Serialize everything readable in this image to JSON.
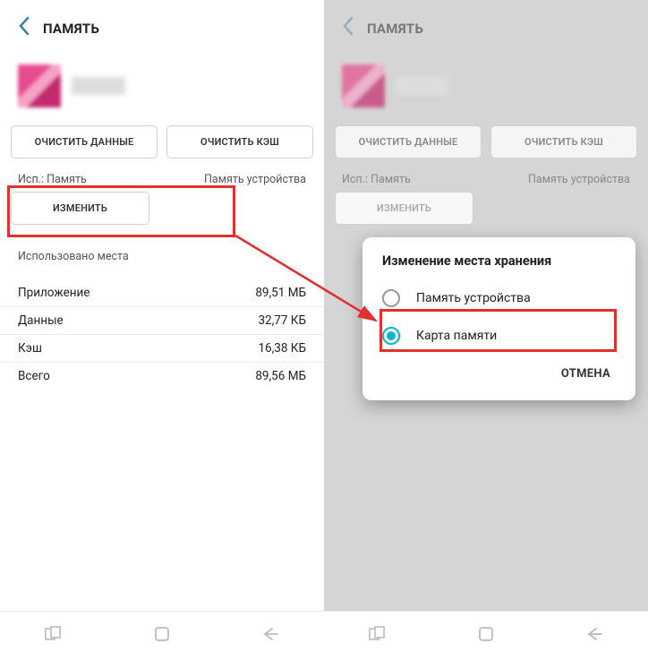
{
  "left": {
    "header_title": "ПАМЯТЬ",
    "clear_data_btn": "ОЧИСТИТЬ ДАННЫЕ",
    "clear_cache_btn": "ОЧИСТИТЬ КЭШ",
    "used_label": "Исп.: Память",
    "storage_label": "Память устройства",
    "change_btn": "ИЗМЕНИТЬ",
    "used_space_label": "Использовано места",
    "rows": [
      {
        "label": "Приложение",
        "value": "89,51 МБ"
      },
      {
        "label": "Данные",
        "value": "32,77 КБ"
      },
      {
        "label": "Кэш",
        "value": "16,38 КБ"
      },
      {
        "label": "Всего",
        "value": "89,56 МБ"
      }
    ]
  },
  "right": {
    "header_title": "ПАМЯТЬ",
    "clear_data_btn": "ОЧИСТИТЬ ДАННЫЕ",
    "clear_cache_btn": "ОЧИСТИТЬ КЭШ",
    "used_label": "Исп.: Память",
    "storage_label": "Память устройства",
    "change_btn": "ИЗМЕНИТЬ"
  },
  "dialog": {
    "title": "Изменение места хранения",
    "option1": "Память устройства",
    "option2": "Карта памяти",
    "cancel": "ОТМЕНА"
  }
}
